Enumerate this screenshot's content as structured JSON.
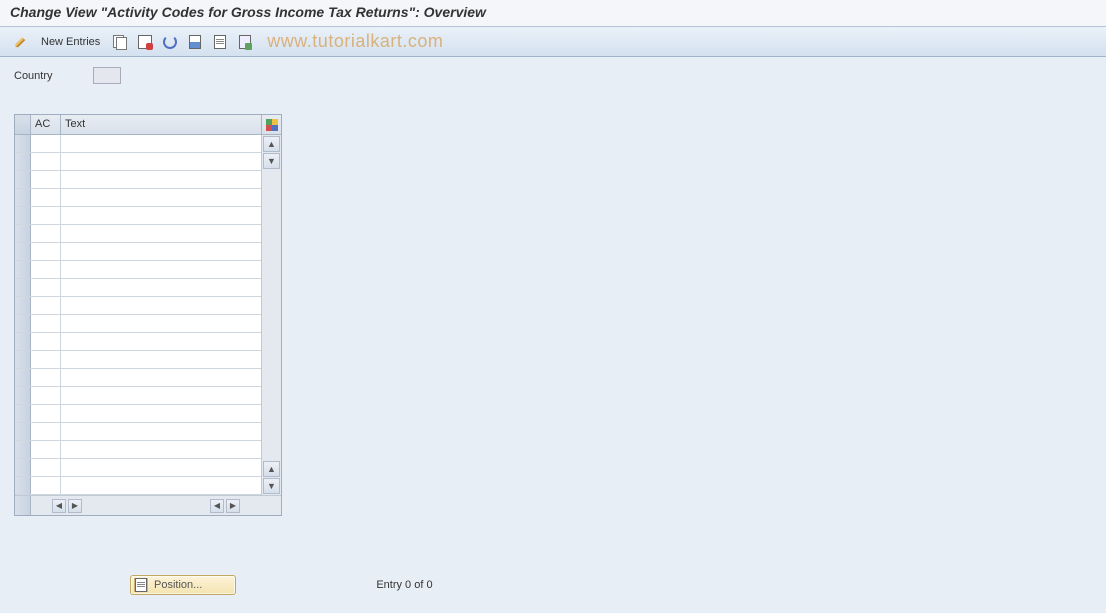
{
  "title": "Change View \"Activity Codes for Gross Income Tax Returns\": Overview",
  "toolbar": {
    "new_entries_label": "New Entries"
  },
  "watermark": "www.tutorialkart.com",
  "fields": {
    "country_label": "Country",
    "country_value": ""
  },
  "table": {
    "columns": {
      "ac": "AC",
      "text": "Text"
    },
    "rows": [
      {
        "ac": "",
        "text": ""
      },
      {
        "ac": "",
        "text": ""
      },
      {
        "ac": "",
        "text": ""
      },
      {
        "ac": "",
        "text": ""
      },
      {
        "ac": "",
        "text": ""
      },
      {
        "ac": "",
        "text": ""
      },
      {
        "ac": "",
        "text": ""
      },
      {
        "ac": "",
        "text": ""
      },
      {
        "ac": "",
        "text": ""
      },
      {
        "ac": "",
        "text": ""
      },
      {
        "ac": "",
        "text": ""
      },
      {
        "ac": "",
        "text": ""
      },
      {
        "ac": "",
        "text": ""
      },
      {
        "ac": "",
        "text": ""
      },
      {
        "ac": "",
        "text": ""
      },
      {
        "ac": "",
        "text": ""
      },
      {
        "ac": "",
        "text": ""
      },
      {
        "ac": "",
        "text": ""
      },
      {
        "ac": "",
        "text": ""
      },
      {
        "ac": "",
        "text": ""
      }
    ]
  },
  "footer": {
    "position_label": "Position...",
    "entry_text": "Entry 0 of 0"
  }
}
